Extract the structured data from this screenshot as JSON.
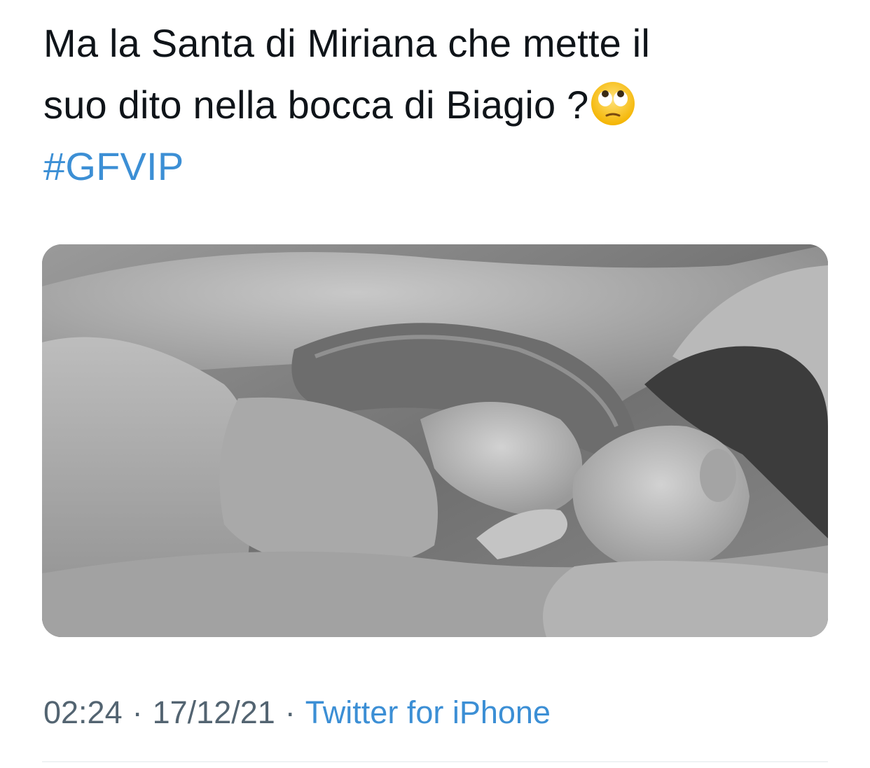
{
  "tweet": {
    "text_line_1": "Ma la Santa di Miriana che mette il",
    "text_line_2": "suo dito nella bocca di Biagio ?",
    "emoji_icon": "face-with-rolling-eyes-icon",
    "hashtag": "#GFVIP"
  },
  "meta": {
    "time": "02:24",
    "separator": "·",
    "date": "17/12/21",
    "source": "Twitter for iPhone"
  },
  "colors": {
    "text": "#0f1419",
    "link": "#3c8fd5",
    "meta": "#536471",
    "divider": "#eff3f4"
  }
}
